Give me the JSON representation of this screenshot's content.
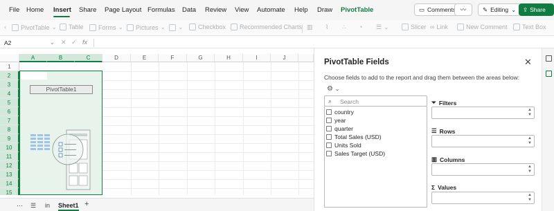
{
  "menu": {
    "tabs": [
      {
        "label": "File"
      },
      {
        "label": "Home"
      },
      {
        "label": "Insert"
      },
      {
        "label": "Share"
      },
      {
        "label": "Page Layout"
      },
      {
        "label": "Formulas"
      },
      {
        "label": "Data"
      },
      {
        "label": "Review"
      },
      {
        "label": "View"
      },
      {
        "label": "Automate"
      },
      {
        "label": "Help"
      },
      {
        "label": "Draw"
      },
      {
        "label": "PivotTable"
      }
    ],
    "active_tab": "Insert",
    "comments_label": "Comments",
    "editing_label": "Editing",
    "share_label": "Share"
  },
  "ribbon": {
    "items": [
      "PivotTable",
      "Table",
      "Forms",
      "Pictures",
      "Checkbox",
      "Recommended Charts",
      "Slicer",
      "Link",
      "New Comment",
      "Text Box"
    ]
  },
  "formula_bar": {
    "name_box": "A2",
    "formula": ""
  },
  "grid": {
    "columns": [
      "A",
      "B",
      "C",
      "D",
      "E",
      "F",
      "G",
      "H",
      "I",
      "J"
    ],
    "rows": [
      "1",
      "2",
      "3",
      "4",
      "5",
      "6",
      "7",
      "8",
      "9",
      "10",
      "11",
      "12",
      "13",
      "14",
      "15"
    ],
    "pivot_placeholder": "PivotTable1"
  },
  "sheets": {
    "tabs": [
      "in",
      "Sheet1"
    ],
    "active": "Sheet1"
  },
  "pivot_panel": {
    "title": "PivotTable Fields",
    "description": "Choose fields to add to the report and drag them between the areas below:",
    "search_placeholder": "Search",
    "fields": [
      "country",
      "year",
      "quarter",
      "Total Sales (USD)",
      "Units Sold",
      "Sales Target (USD)"
    ],
    "areas": {
      "filters": "Filters",
      "rows": "Rows",
      "columns": "Columns",
      "values": "Values"
    }
  },
  "colors": {
    "accent": "#107c41",
    "selection_fill": "#e8f3ec"
  }
}
